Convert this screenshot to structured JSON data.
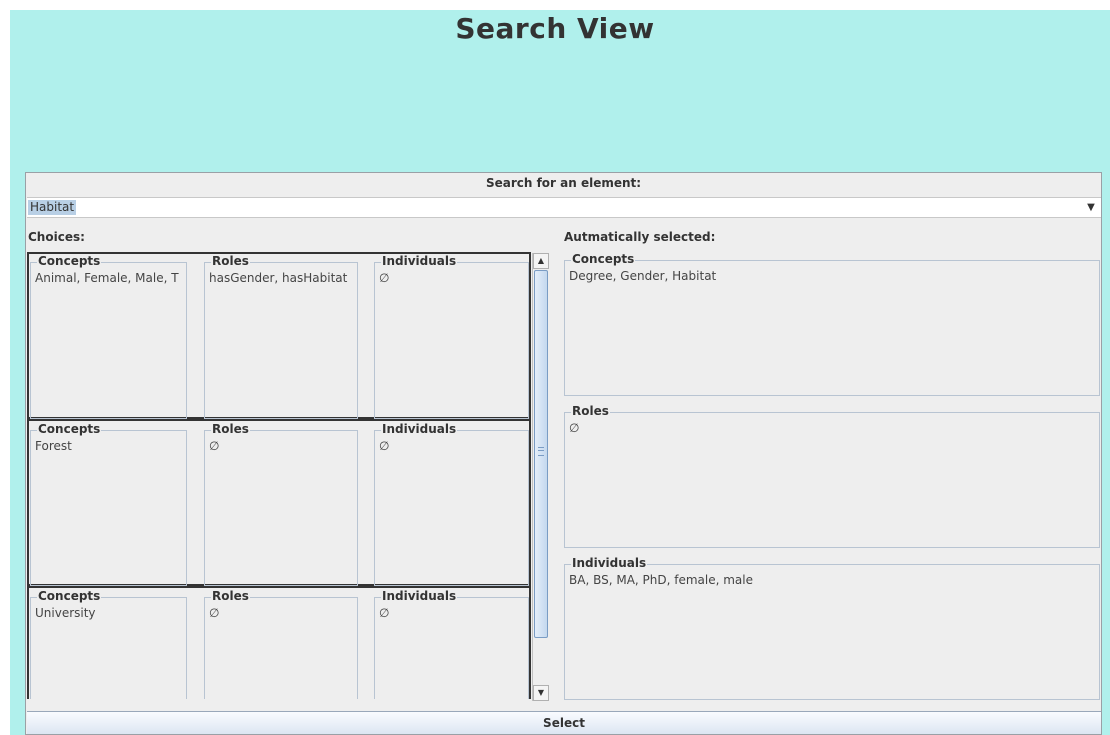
{
  "page": {
    "title": "Search View",
    "background": "#b0f0ec"
  },
  "search": {
    "label": "Search for an element:",
    "value": "Habitat"
  },
  "choices": {
    "label": "Choices:",
    "rows": [
      {
        "concepts_title": "Concepts",
        "concepts": "Animal, Female, Male, T",
        "roles_title": "Roles",
        "roles": "hasGender, hasHabitat",
        "individuals_title": "Individuals",
        "individuals": "∅"
      },
      {
        "concepts_title": "Concepts",
        "concepts": "Forest",
        "roles_title": "Roles",
        "roles": "∅",
        "individuals_title": "Individuals",
        "individuals": "∅"
      },
      {
        "concepts_title": "Concepts",
        "concepts": "University",
        "roles_title": "Roles",
        "roles": "∅",
        "individuals_title": "Individuals",
        "individuals": "∅"
      }
    ]
  },
  "selected": {
    "label": "Autmatically selected:",
    "concepts_title": "Concepts",
    "concepts": "Degree, Gender, Habitat",
    "roles_title": "Roles",
    "roles": "∅",
    "individuals_title": "Individuals",
    "individuals": "BA, BS, MA, PhD, female, male"
  },
  "select_button": {
    "label": "Select"
  },
  "icons": {
    "dropdown": "chevron-down-icon",
    "scroll_up": "arrow-up-icon",
    "scroll_down": "arrow-down-icon"
  }
}
